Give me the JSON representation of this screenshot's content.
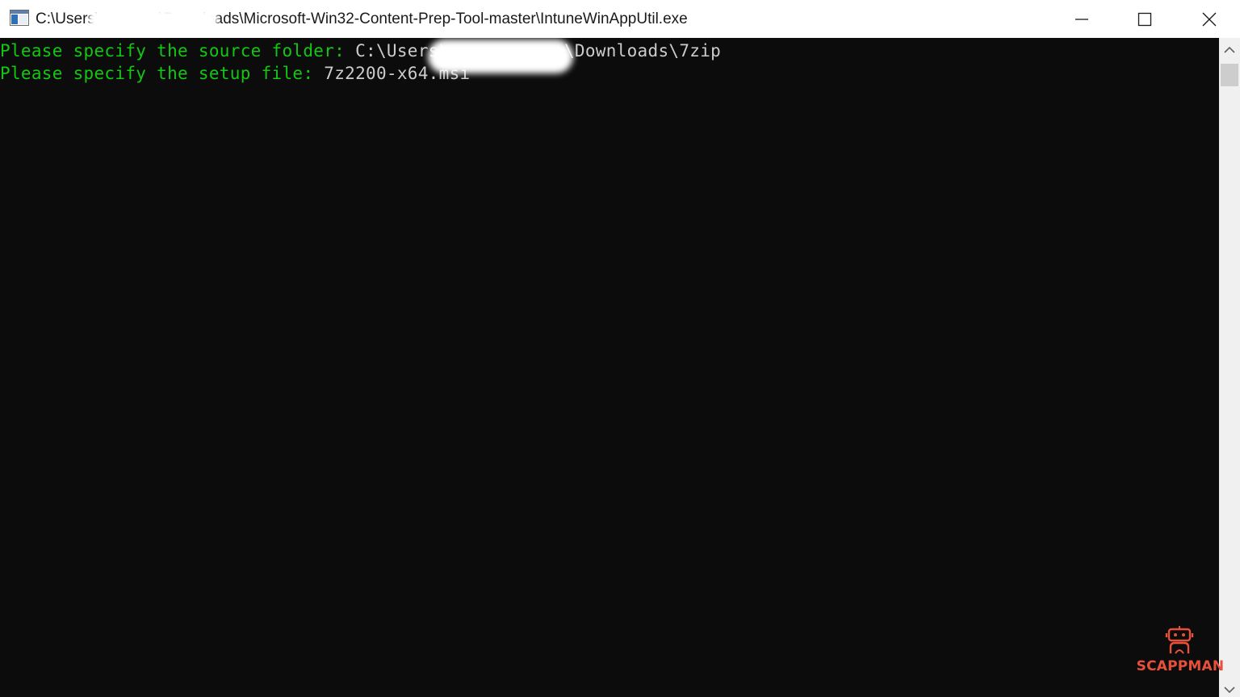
{
  "window": {
    "title": "C:\\Users\\ ·········· \\Downloads\\Microsoft-Win32-Content-Prep-Tool-master\\IntuneWinAppUtil.exe",
    "controls": {
      "minimize_icon": "minimize-icon",
      "maximize_icon": "maximize-icon",
      "close_icon": "close-icon"
    }
  },
  "console": {
    "lines": [
      {
        "prompt": "Please specify the source folder: ",
        "value_before": "C:\\Users\\",
        "value_after": "\\Downloads\\7zip"
      },
      {
        "prompt": "Please specify the setup file: ",
        "value": "7z2200-x64.msi"
      }
    ],
    "colors": {
      "background": "#0c0c0c",
      "prompt": "#13c713",
      "input": "#cccccc"
    }
  },
  "watermark": {
    "text": "SCAPPMAN",
    "color": "#e8503a",
    "icon": "robot-icon"
  }
}
